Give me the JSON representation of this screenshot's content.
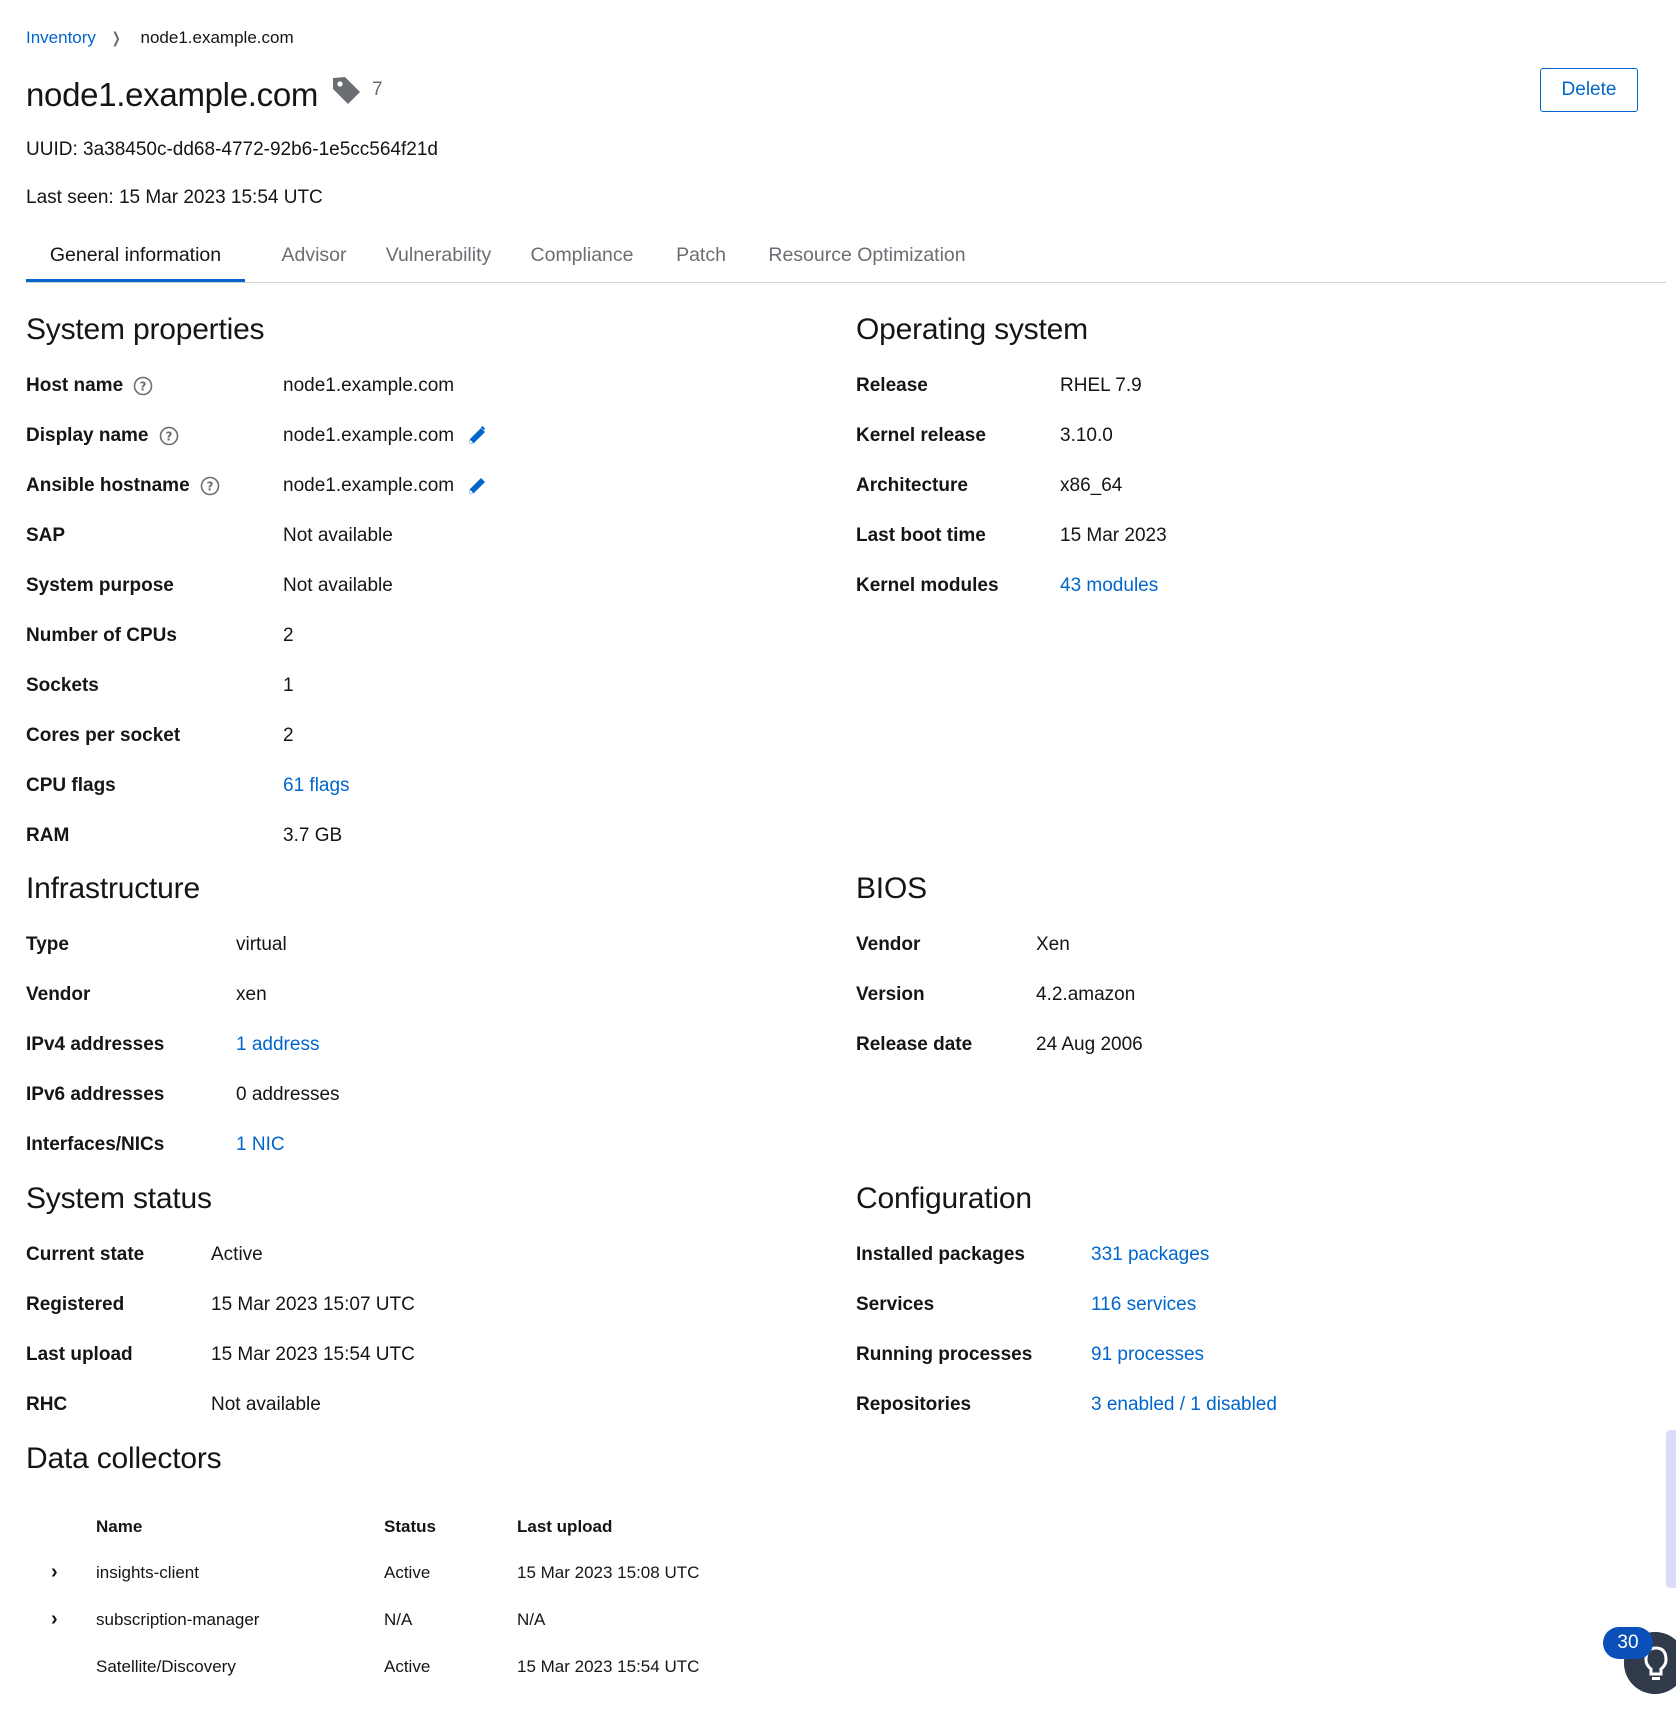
{
  "breadcrumb": {
    "parent": "Inventory",
    "current": "node1.example.com"
  },
  "header": {
    "title": "node1.example.com",
    "tag_count": "7",
    "delete_label": "Delete",
    "uuid": "UUID: 3a38450c-dd68-4772-92b6-1e5cc564f21d",
    "last_seen": "Last seen: 15 Mar 2023 15:54 UTC"
  },
  "tabs": [
    {
      "label": "General information",
      "active": true
    },
    {
      "label": "Advisor"
    },
    {
      "label": "Vulnerability"
    },
    {
      "label": "Compliance"
    },
    {
      "label": "Patch"
    },
    {
      "label": "Resource Optimization"
    }
  ],
  "system_properties": {
    "title": "System properties",
    "rows": [
      {
        "label": "Host name",
        "value": "node1.example.com"
      },
      {
        "label": "Display name",
        "value": "node1.example.com"
      },
      {
        "label": "Ansible hostname",
        "value": "node1.example.com"
      },
      {
        "label": "SAP",
        "value": "Not available"
      },
      {
        "label": "System purpose",
        "value": "Not available"
      },
      {
        "label": "Number of CPUs",
        "value": "2"
      },
      {
        "label": "Sockets",
        "value": "1"
      },
      {
        "label": "Cores per socket",
        "value": "2"
      },
      {
        "label": "CPU flags",
        "value": "61 flags"
      },
      {
        "label": "RAM",
        "value": "3.7 GB"
      }
    ]
  },
  "operating_system": {
    "title": "Operating system",
    "rows": [
      {
        "label": "Release",
        "value": "RHEL 7.9"
      },
      {
        "label": "Kernel release",
        "value": "3.10.0"
      },
      {
        "label": "Architecture",
        "value": "x86_64"
      },
      {
        "label": "Last boot time",
        "value": "15 Mar 2023"
      },
      {
        "label": "Kernel modules",
        "value": "43 modules"
      }
    ]
  },
  "infrastructure": {
    "title": "Infrastructure",
    "rows": [
      {
        "label": "Type",
        "value": "virtual"
      },
      {
        "label": "Vendor",
        "value": "xen"
      },
      {
        "label": "IPv4 addresses",
        "value": "1 address"
      },
      {
        "label": "IPv6 addresses",
        "value": "0 addresses"
      },
      {
        "label": "Interfaces/NICs",
        "value": "1 NIC"
      }
    ]
  },
  "bios": {
    "title": "BIOS",
    "rows": [
      {
        "label": "Vendor",
        "value": "Xen"
      },
      {
        "label": "Version",
        "value": "4.2.amazon"
      },
      {
        "label": "Release date",
        "value": "24 Aug 2006"
      }
    ]
  },
  "system_status": {
    "title": "System status",
    "rows": [
      {
        "label": "Current state",
        "value": "Active"
      },
      {
        "label": "Registered",
        "value": "15 Mar 2023 15:07 UTC"
      },
      {
        "label": "Last upload",
        "value": "15 Mar 2023 15:54 UTC"
      },
      {
        "label": "RHC",
        "value": "Not available"
      }
    ]
  },
  "configuration": {
    "title": "Configuration",
    "rows": [
      {
        "label": "Installed packages",
        "value": "331 packages"
      },
      {
        "label": "Services",
        "value": "116 services"
      },
      {
        "label": "Running processes",
        "value": "91 processes"
      },
      {
        "label": "Repositories",
        "value": "3 enabled / 1 disabled"
      }
    ]
  },
  "data_collectors": {
    "title": "Data collectors",
    "headers": {
      "name": "Name",
      "status": "Status",
      "last_upload": "Last upload"
    },
    "rows": [
      {
        "name": "insights-client",
        "status": "Active",
        "last_upload": "15 Mar 2023 15:08 UTC"
      },
      {
        "name": "subscription-manager",
        "status": "N/A",
        "last_upload": "N/A"
      },
      {
        "name": "Satellite/Discovery",
        "status": "Active",
        "last_upload": "15 Mar 2023 15:54 UTC"
      }
    ]
  },
  "notification_badge": "30",
  "icons": {
    "tag": "tag-icon",
    "help": "help-circle-icon",
    "edit": "pencil-icon",
    "expand": "chevron-right-icon",
    "launcher": "help-launcher-icon"
  },
  "colors": {
    "link": "#0066cc",
    "active_tab": "#0066cc",
    "badge": "#0b4fb8"
  }
}
